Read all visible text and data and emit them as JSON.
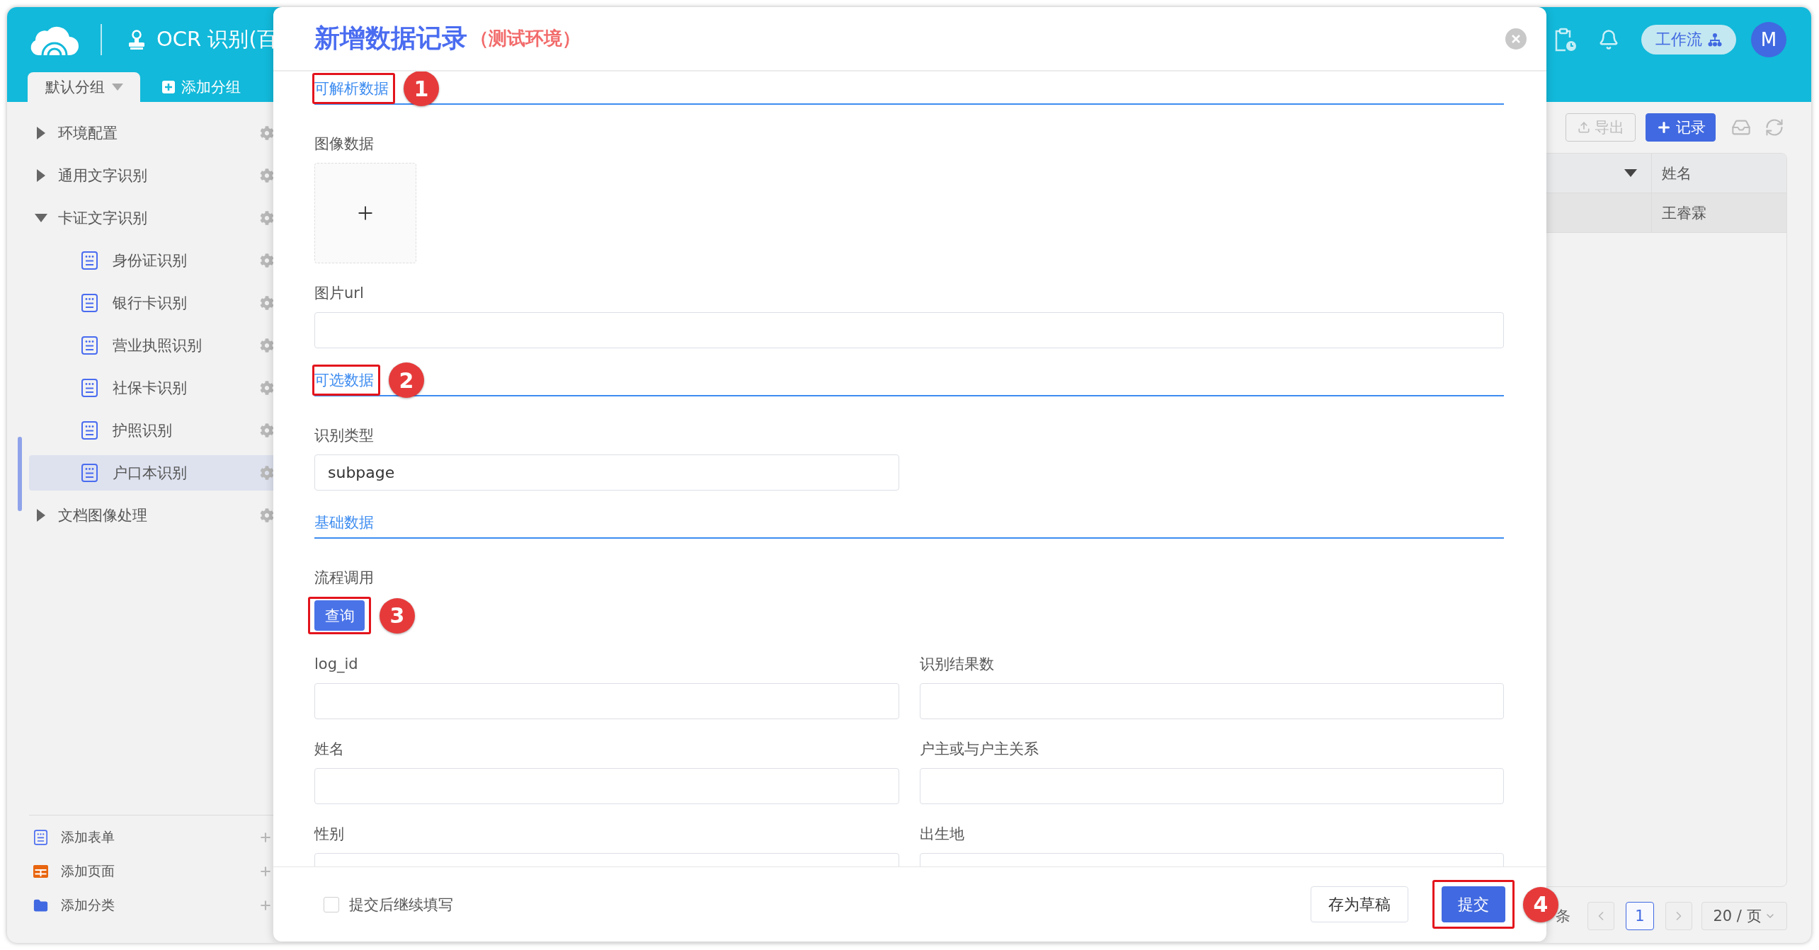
{
  "header": {
    "app_title": "OCR 识别(百",
    "group_tabs": [
      {
        "label": "默认分组",
        "selected": true
      }
    ],
    "add_group": "添加分组",
    "workflow": "工作流",
    "avatar": "M"
  },
  "sidebar": {
    "items": [
      {
        "label": "环境配置",
        "kind": "folder",
        "expanded": false,
        "selected": false
      },
      {
        "label": "通用文字识别",
        "kind": "folder",
        "expanded": false,
        "selected": false
      },
      {
        "label": "卡证文字识别",
        "kind": "folder",
        "expanded": true,
        "selected": false,
        "children": [
          {
            "label": "身份证识别",
            "kind": "form",
            "selected": false
          },
          {
            "label": "银行卡识别",
            "kind": "form",
            "selected": false
          },
          {
            "label": "营业执照识别",
            "kind": "form",
            "selected": false
          },
          {
            "label": "社保卡识别",
            "kind": "form",
            "selected": false
          },
          {
            "label": "护照识别",
            "kind": "form",
            "selected": false
          },
          {
            "label": "户口本识别",
            "kind": "form",
            "selected": true
          }
        ]
      },
      {
        "label": "文档图像处理",
        "kind": "folder",
        "expanded": false,
        "selected": false
      }
    ],
    "actions": [
      {
        "label": "添加表单",
        "kind": "form"
      },
      {
        "label": "添加页面",
        "kind": "page"
      },
      {
        "label": "添加分类",
        "kind": "folder"
      }
    ]
  },
  "toolbar": {
    "buttons": [
      {
        "label": "导出",
        "kind": "export",
        "disabled": true
      },
      {
        "label": "记录",
        "kind": "add",
        "disabled": false
      }
    ]
  },
  "table": {
    "columns": [
      {
        "label": "姓名"
      }
    ],
    "rows": [
      {
        "cells": [
          "王睿霖"
        ]
      }
    ]
  },
  "pagination": {
    "total_suffix": "条",
    "pages": [
      {
        "label": "1",
        "selected": true
      }
    ],
    "page_size": "20 / 页"
  },
  "dialog": {
    "title": "新增数据记录",
    "note": "（测试环境）",
    "sections": [
      {
        "title": "可解析数据",
        "annotation": "1",
        "fields": [
          {
            "kind": "upload",
            "label": "图像数据"
          },
          {
            "kind": "url",
            "label": "图片url"
          }
        ]
      },
      {
        "title": "可选数据",
        "annotation": "2",
        "fields": [
          {
            "kind": "text",
            "label": "识别类型",
            "value": "subpage"
          }
        ]
      },
      {
        "title": "基础数据",
        "fields": [
          {
            "kind": "action",
            "label": "流程调用",
            "button": "查询",
            "annotation": "3"
          },
          {
            "kind": "text",
            "label": "log_id"
          },
          {
            "kind": "text",
            "label": "识别结果数"
          },
          {
            "kind": "text",
            "label": "姓名"
          },
          {
            "kind": "text",
            "label": "户主或与户主关系"
          },
          {
            "kind": "text",
            "label": "性别"
          },
          {
            "kind": "text",
            "label": "出生地"
          }
        ]
      }
    ],
    "footer": {
      "continue": {
        "label": "提交后继续填写",
        "checked": false
      },
      "buttons": [
        {
          "label": "存为草稿",
          "kind": "default"
        },
        {
          "label": "提交",
          "kind": "primary",
          "annotation": "4"
        }
      ]
    }
  }
}
